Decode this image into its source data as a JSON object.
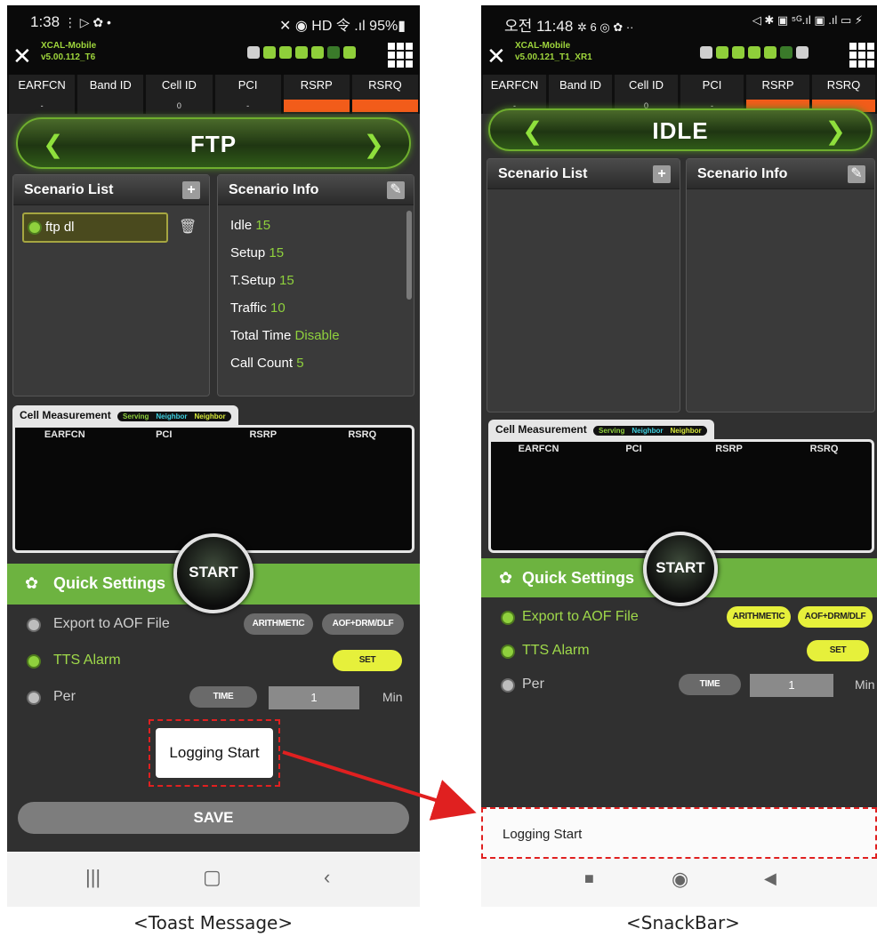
{
  "left": {
    "status": {
      "time": "1:38",
      "time_icons": "⋮ ▷ ✿ •",
      "right": "✕ ◉ HD 令 .ıl 95%▮"
    },
    "app": {
      "name": "XCAL-Mobile",
      "version": "v5.00.112_T6"
    },
    "measurements": [
      {
        "label": "EARFCN",
        "value": "-"
      },
      {
        "label": "Band ID",
        "value": ""
      },
      {
        "label": "Cell ID",
        "value": "0"
      },
      {
        "label": "PCI",
        "value": "-"
      },
      {
        "label": "RSRP",
        "value": ""
      },
      {
        "label": "RSRQ",
        "value": ""
      }
    ],
    "mode": "FTP",
    "scenario_list_title": "Scenario List",
    "scenario_items": [
      "ftp dl"
    ],
    "scenario_info_title": "Scenario Info",
    "info": [
      {
        "k": "Idle",
        "v": "15"
      },
      {
        "k": "Setup",
        "v": "15"
      },
      {
        "k": "T.Setup",
        "v": "15"
      },
      {
        "k": "Traffic",
        "v": "10"
      },
      {
        "k": "Total Time",
        "v": "Disable"
      },
      {
        "k": "Call Count",
        "v": "5"
      }
    ],
    "cell_measurement": {
      "title": "Cell Measurement",
      "pills": [
        "Serving",
        "Neighbor",
        "Neighbor"
      ],
      "columns": [
        "EARFCN",
        "PCI",
        "RSRP",
        "RSRQ"
      ]
    },
    "quick_settings": "Quick Settings",
    "start": "START",
    "options": {
      "export": "Export to AOF File",
      "arith": "ARITHMETIC",
      "aof": "AOF+DRM/DLF",
      "tts": "TTS Alarm",
      "set": "SET",
      "per": "Per",
      "time": "TIME",
      "time_value": "1",
      "unit": "Min"
    },
    "toast": "Logging Start",
    "save": "SAVE",
    "caption": "<Toast Message>"
  },
  "right": {
    "status": {
      "time": "오전 11:48",
      "time_icons": "✲ 6 ◎ ✿ ··",
      "right": "◁ ✱ ▣ ⁵ᴳ.ıl ▣ .ıl ▭ ⚡"
    },
    "app": {
      "name": "XCAL-Mobile",
      "version": "v5.00.121_T1_XR1"
    },
    "measurements": [
      {
        "label": "EARFCN",
        "value": "-"
      },
      {
        "label": "Band ID",
        "value": ""
      },
      {
        "label": "Cell ID",
        "value": "0"
      },
      {
        "label": "PCI",
        "value": "-"
      },
      {
        "label": "RSRP",
        "value": ""
      },
      {
        "label": "RSRQ",
        "value": ""
      }
    ],
    "mode": "IDLE",
    "scenario_list_title": "Scenario List",
    "scenario_info_title": "Scenario Info",
    "cell_measurement": {
      "title": "Cell Measurement",
      "pills": [
        "Serving",
        "Neighbor",
        "Neighbor"
      ],
      "columns": [
        "EARFCN",
        "PCI",
        "RSRP",
        "RSRQ"
      ]
    },
    "quick_settings": "Quick Settings",
    "start": "START",
    "options": {
      "export": "Export to AOF File",
      "arith": "ARITHMETIC",
      "aof": "AOF+DRM/DLF",
      "tts": "TTS Alarm",
      "set": "SET",
      "per": "Per",
      "time": "TIME",
      "time_value": "1",
      "unit": "Min"
    },
    "snackbar": "Logging Start",
    "caption": "<SnackBar>"
  },
  "colors": {
    "accent_green": "#6db340",
    "highlight_green": "#8fd13d",
    "orange": "#f25c1a",
    "annotation_red": "#e02020"
  }
}
